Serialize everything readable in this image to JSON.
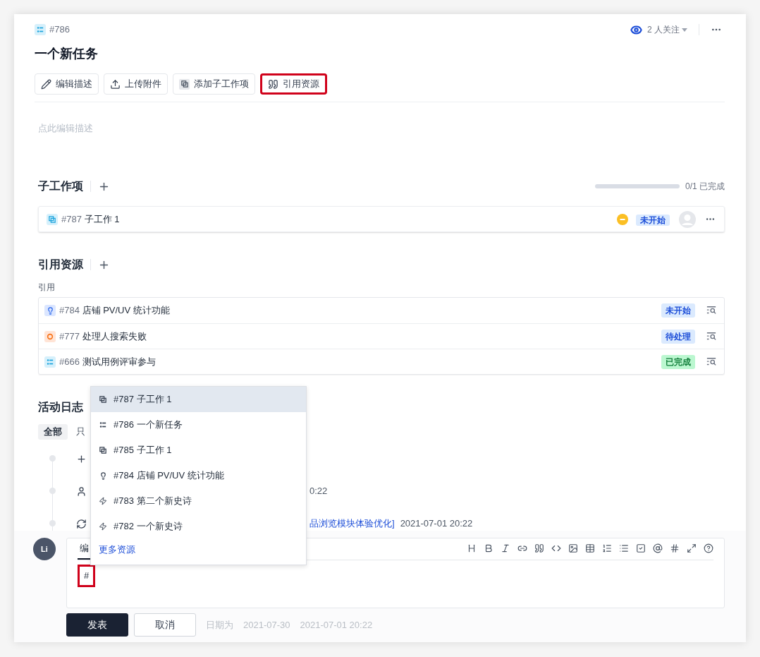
{
  "header": {
    "item_id": "#786",
    "kind": "task",
    "watchers": "2 人关注"
  },
  "title": "一个新任务",
  "actions": [
    {
      "label": "编辑描述",
      "kind": "edit",
      "highlighted": false
    },
    {
      "label": "上传附件",
      "kind": "upload",
      "highlighted": false
    },
    {
      "label": "添加子工作项",
      "kind": "subtask",
      "highlighted": false
    },
    {
      "label": "引用资源",
      "kind": "quote",
      "highlighted": true
    }
  ],
  "description": {
    "placeholder": "点此编辑描述"
  },
  "subtasks": {
    "title": "子工作项",
    "progress": {
      "level": 0,
      "text": "0/1 已完成"
    },
    "items": [
      {
        "id": "#787",
        "name": "子工作 1",
        "kind": "subtask",
        "status": {
          "text": "未开始",
          "kind": "todo"
        }
      }
    ]
  },
  "references": {
    "title": "引用资源",
    "group": "引用",
    "items": [
      {
        "id": "#784",
        "name": "店铺 PV/UV 统计功能",
        "kind": "idea",
        "status": {
          "text": "未开始",
          "kind": "todo"
        }
      },
      {
        "id": "#777",
        "name": "处理人搜索失败",
        "kind": "bug",
        "status": {
          "text": "待处理",
          "kind": "todo"
        }
      },
      {
        "id": "#666",
        "name": "测试用例评审参与",
        "kind": "task",
        "status": {
          "text": "已完成",
          "kind": "done"
        }
      }
    ]
  },
  "activity": {
    "title": "活动日志",
    "tabs": [
      {
        "label": "全部",
        "selected": true
      },
      {
        "label": "只",
        "selected": false
      }
    ],
    "entries": [
      {
        "kind": "plus"
      },
      {
        "kind": "user",
        "time": "0:22"
      },
      {
        "kind": "refresh",
        "link": "品浏览模块体验优化]",
        "time": "2021-07-01 20:22"
      }
    ]
  },
  "composer": {
    "avatar": "Li",
    "tabs": [
      {
        "label": "编",
        "selected": true
      }
    ],
    "toolbar": [
      {
        "kind": "heading"
      },
      {
        "kind": "bold"
      },
      {
        "kind": "italic"
      },
      {
        "kind": "link"
      },
      {
        "kind": "quote"
      },
      {
        "kind": "code"
      },
      {
        "kind": "image"
      },
      {
        "kind": "table"
      },
      {
        "kind": "ordered-list"
      },
      {
        "kind": "bullet-list"
      },
      {
        "kind": "checkbox"
      },
      {
        "kind": "at"
      },
      {
        "kind": "hash"
      },
      {
        "kind": "expand"
      },
      {
        "kind": "help"
      }
    ],
    "value": "#",
    "value_highlighted": true,
    "buttons": [
      {
        "label": "发表",
        "kind": "primary"
      },
      {
        "label": "取消",
        "kind": "secondary"
      }
    ],
    "faded_texts": [
      "日期为",
      "2021-07-30",
      "2021-07-01 20:22"
    ]
  },
  "menu": {
    "items": [
      {
        "id": "#787",
        "name": "子工作 1",
        "kind": "subtask",
        "selected": true
      },
      {
        "id": "#786",
        "name": "一个新任务",
        "kind": "task",
        "selected": false
      },
      {
        "id": "#785",
        "name": "子工作 1",
        "kind": "subtask",
        "selected": false
      },
      {
        "id": "#784",
        "name": "店铺 PV/UV 统计功能",
        "kind": "idea",
        "selected": false
      },
      {
        "id": "#783",
        "name": "第二个新史诗",
        "kind": "epic",
        "selected": false
      },
      {
        "id": "#782",
        "name": "一个新史诗",
        "kind": "epic",
        "selected": false
      }
    ],
    "more": "更多资源"
  }
}
